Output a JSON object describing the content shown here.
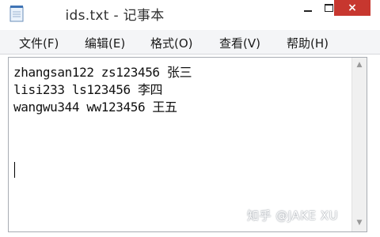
{
  "window": {
    "title": "ids.txt - 记事本",
    "icon": "notepad-icon",
    "controls": {
      "minimize": "minimize-icon",
      "maximize": "maximize-icon",
      "close": "×"
    }
  },
  "menu": {
    "items": [
      {
        "label": "文件(F)"
      },
      {
        "label": "编辑(E)"
      },
      {
        "label": "格式(O)"
      },
      {
        "label": "查看(V)"
      },
      {
        "label": "帮助(H)"
      }
    ]
  },
  "editor": {
    "lines": [
      "zhangsan122 zs123456 张三",
      "lisi233 ls123456 李四",
      "wangwu344 ww123456 王五"
    ]
  },
  "watermark": {
    "text": "知乎 @JAKE XU"
  },
  "colors": {
    "close_button": "#c7372f",
    "menubar": "#f4f5f7",
    "editor_border": "#a8acb3"
  }
}
